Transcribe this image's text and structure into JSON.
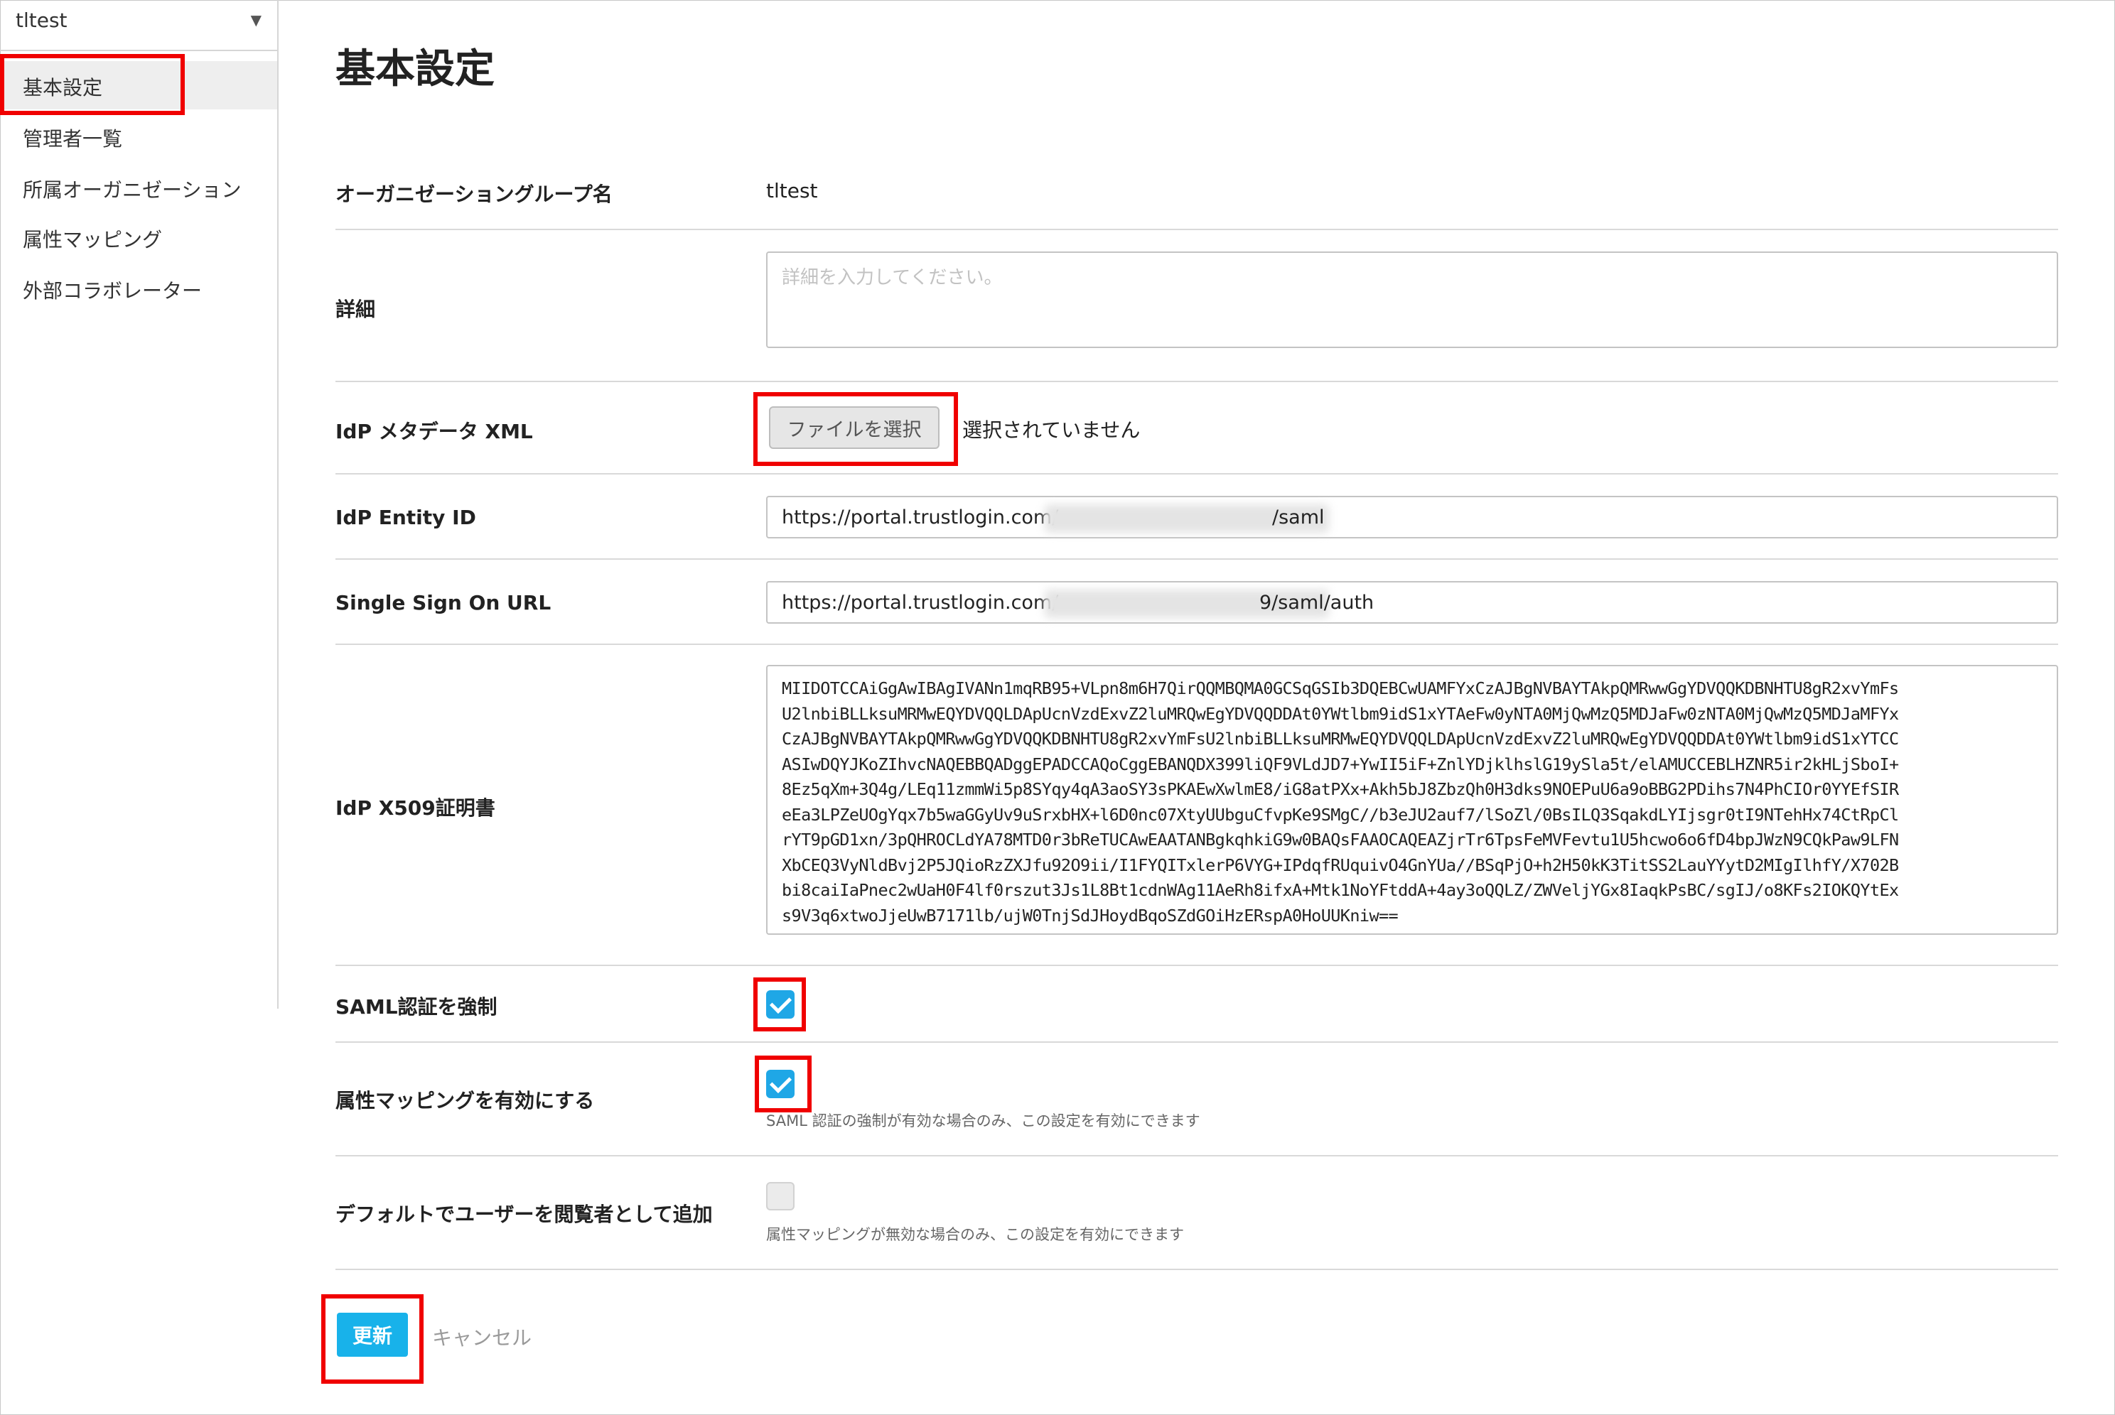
{
  "sidebar": {
    "org_selector": {
      "label": "tltest"
    },
    "items": [
      {
        "label": "基本設定",
        "active": true
      },
      {
        "label": "管理者一覧"
      },
      {
        "label": "所属オーガニゼーション"
      },
      {
        "label": "属性マッピング"
      },
      {
        "label": "外部コラボレーター"
      }
    ]
  },
  "main": {
    "title": "基本設定",
    "org_group": {
      "label": "オーガニゼーショングループ名",
      "value": "tltest"
    },
    "details": {
      "label": "詳細",
      "placeholder": "詳細を入力してください。",
      "value": ""
    },
    "idp_metadata": {
      "label": "IdP メタデータ XML",
      "button": "ファイルを選択",
      "status": "選択されていません"
    },
    "idp_entity_id": {
      "label": "IdP Entity ID",
      "prefix": "https://portal.trustlogin.com/",
      "suffix": "/saml"
    },
    "sso_url": {
      "label": "Single Sign On URL",
      "prefix": "https://portal.trustlogin.com/",
      "suffix": "9/saml/auth"
    },
    "x509": {
      "label": "IdP X509証明書",
      "lines": [
        "MIIDOTCCAiGgAwIBAgIVANn1mqRB95+VLpn8m6H7QirQQMBQMA0GCSqGSIb3DQEBCwUAMFYxCzAJBgNVBAYTAkpQMRwwGgYDVQQKDBNHTU8gR2xvYmFs",
        "U2lnbiBLLksuMRMwEQYDVQQLDApUcnVzdExvZ2luMRQwEgYDVQQDDAt0YWtlbm9idS1xYTAeFw0yNTA0MjQwMzQ5MDJaFw0zNTA0MjQwMzQ5MDJaMFYx",
        "CzAJBgNVBAYTAkpQMRwwGgYDVQQKDBNHTU8gR2xvYmFsU2lnbiBLLksuMRMwEQYDVQQLDApUcnVzdExvZ2luMRQwEgYDVQQDDAt0YWtlbm9idS1xYTCC",
        "ASIwDQYJKoZIhvcNAQEBBQADggEPADCCAQoCggEBANQDX399liQF9VLdJD7+YwII5iF+ZnlYDjklhslG19ySla5t/elAMUCCEBLHZNR5ir2kHLjSboI+",
        "8Ez5qXm+3Q4g/LEq11zmmWi5p8SYqy4qA3aoSY3sPKAEwXwlmE8/iG8atPXx+Akh5bJ8ZbzQh0H3dks9NOEPuU6a9oBBG2PDihs7N4PhCIOr0YYEfSIR",
        "eEa3LPZeUOgYqx7b5waGGyUv9uSrxbHX+l6D0nc07XtyUUbguCfvpKe9SMgC//b3eJU2auf7/lSoZl/0BsILQ3SqakdLYIjsgr0tI9NTehHx74CtRpCl",
        "rYT9pGD1xn/3pQHROCLdYA78MTD0r3bReTUCAwEAATANBgkqhkiG9w0BAQsFAAOCAQEAZjrTr6TpsFeMVFevtu1U5hcwo6o6fD4bpJWzN9CQkPaw9LFN",
        "XbCEQ3VyNldBvj2P5JQioRzZXJfu92O9ii/I1FYQITxlerP6VYG+IPdqfRUquivO4GnYUa//BSqPjO+h2H50kK3TitSS2LauYYytD2MIgIlhfY/X702B",
        "bi8caiIaPnec2wUaH0F4lf0rszut3Js1L8Bt1cdnWAg11AeRh8ifxA+Mtk1NoYFtddA+4ay3oQQLZ/ZWVeljYGx8IaqkPsBC/sgIJ/o8KFs2IOKQYtEx",
        "s9V3q6xtwoJjeUwB7171lb/ujW0TnjSdJHoydBqoSZdGOiHzERspA0HoUUKniw=="
      ]
    },
    "saml_force": {
      "label": "SAML認証を強制",
      "checked": true
    },
    "attr_mapping": {
      "label": "属性マッピングを有効にする",
      "checked": true,
      "help": "SAML 認証の強制が有効な場合のみ、この設定を有効にできます"
    },
    "default_viewer": {
      "label": "デフォルトでユーザーを閲覧者として追加",
      "checked": false,
      "help": "属性マッピングが無効な場合のみ、この設定を有効にできます"
    },
    "actions": {
      "update": "更新",
      "cancel": "キャンセル"
    }
  },
  "colors": {
    "accent": "#18b2ea",
    "checkbox": "#1fa7e6",
    "highlight": "#f00000"
  }
}
